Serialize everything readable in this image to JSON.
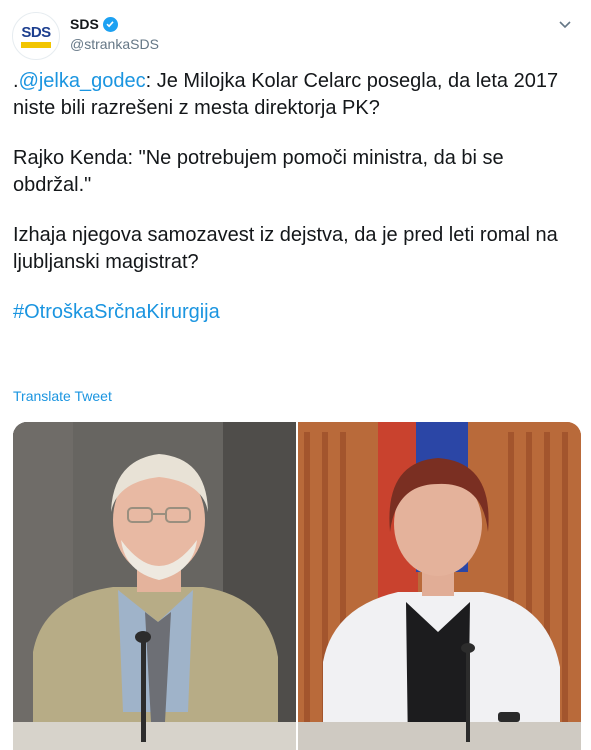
{
  "account": {
    "display_name": "SDS",
    "handle": "@strankaSDS",
    "verified": true,
    "avatar_logo_text": "SDS",
    "brand_colors": {
      "blue": "#1d3f8f",
      "yellow": "#f2c500"
    }
  },
  "tweet": {
    "prefix": ".",
    "mention": "@jelka_godec",
    "para1_rest": ": Je Milojka Kolar Celarc posegla, da leta 2017 niste bili razrešeni z mesta direktorja PK?",
    "para2": "Rajko Kenda: \"Ne potrebujem pomoči ministra, da bi se obdržal.\"",
    "para3": "Izhaja njegova samozavest iz dejstva, da je pred leti romal na ljubljanski magistrat?",
    "hashtag": "#OtroškaSrčnaKirurgija",
    "translate_label": "Translate Tweet"
  },
  "media": {
    "images": [
      "man-at-hearing-photo",
      "woman-at-hearing-photo"
    ]
  },
  "colors": {
    "link": "#1b95e0",
    "text": "#14171a",
    "muted": "#657786"
  },
  "icons": {
    "verified": "verified-badge-icon",
    "menu": "chevron-down-icon"
  }
}
